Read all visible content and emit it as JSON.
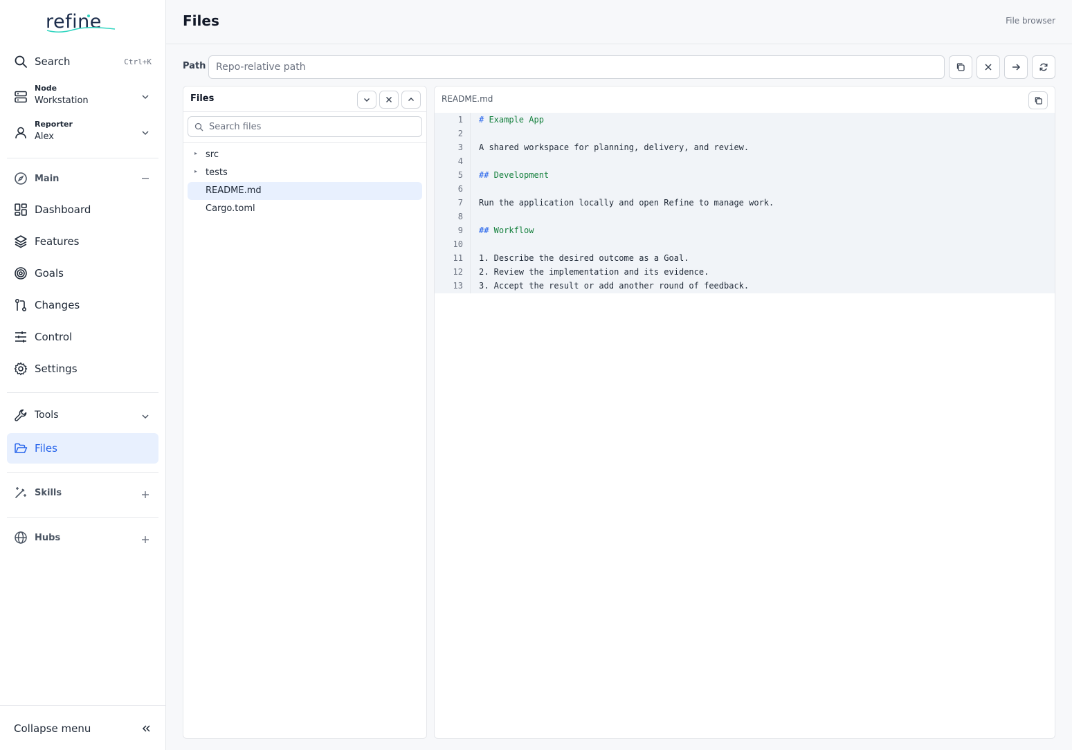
{
  "app": {
    "logo_text": "refine"
  },
  "sidebar": {
    "search": {
      "label": "Search",
      "shortcut": "Ctrl+K"
    },
    "node": {
      "caption": "Node",
      "value": "Workstation"
    },
    "reporter": {
      "caption": "Reporter",
      "value": "Alex"
    },
    "main_section": "Main",
    "items": [
      {
        "label": "Dashboard",
        "icon": "dashboard-icon"
      },
      {
        "label": "Features",
        "icon": "layers-icon"
      },
      {
        "label": "Goals",
        "icon": "target-icon"
      },
      {
        "label": "Changes",
        "icon": "git-pull-request-icon"
      },
      {
        "label": "Control",
        "icon": "sliders-icon"
      },
      {
        "label": "Settings",
        "icon": "gear-icon"
      }
    ],
    "tools": {
      "label": "Tools"
    },
    "files": {
      "label": "Files"
    },
    "skills": {
      "label": "Skills"
    },
    "hubs": {
      "label": "Hubs"
    },
    "collapse_label": "Collapse menu"
  },
  "header": {
    "title": "Files",
    "subtitle": "File browser"
  },
  "path_bar": {
    "label": "Path",
    "placeholder": "Repo-relative path",
    "value": ""
  },
  "files_panel": {
    "title": "Files",
    "search_placeholder": "Search files",
    "tree": [
      {
        "name": "src",
        "type": "folder",
        "caret": "▸"
      },
      {
        "name": "tests",
        "type": "folder",
        "caret": "▸"
      },
      {
        "name": "README.md",
        "type": "file",
        "selected": true
      },
      {
        "name": "Cargo.toml",
        "type": "file"
      }
    ]
  },
  "viewer": {
    "file_name": "README.md",
    "lines": [
      {
        "n": "1",
        "hash": "#",
        "text": " Example App",
        "kind": "heading"
      },
      {
        "n": "2",
        "text": ""
      },
      {
        "n": "3",
        "text": "A shared workspace for planning, delivery, and review."
      },
      {
        "n": "4",
        "text": ""
      },
      {
        "n": "5",
        "hash": "##",
        "text": " Development",
        "kind": "heading"
      },
      {
        "n": "6",
        "text": ""
      },
      {
        "n": "7",
        "text": "Run the application locally and open Refine to manage work."
      },
      {
        "n": "8",
        "text": ""
      },
      {
        "n": "9",
        "hash": "##",
        "text": " Workflow",
        "kind": "heading"
      },
      {
        "n": "10",
        "text": ""
      },
      {
        "n": "11",
        "text": "1. Describe the desired outcome as a Goal."
      },
      {
        "n": "12",
        "text": "2. Review the implementation and its evidence."
      },
      {
        "n": "13",
        "text": "3. Accept the result or add another round of feedback."
      }
    ]
  },
  "colors": {
    "accent": "#2563eb",
    "active_bg": "#e8f0fe",
    "heading_green": "#15803d"
  }
}
